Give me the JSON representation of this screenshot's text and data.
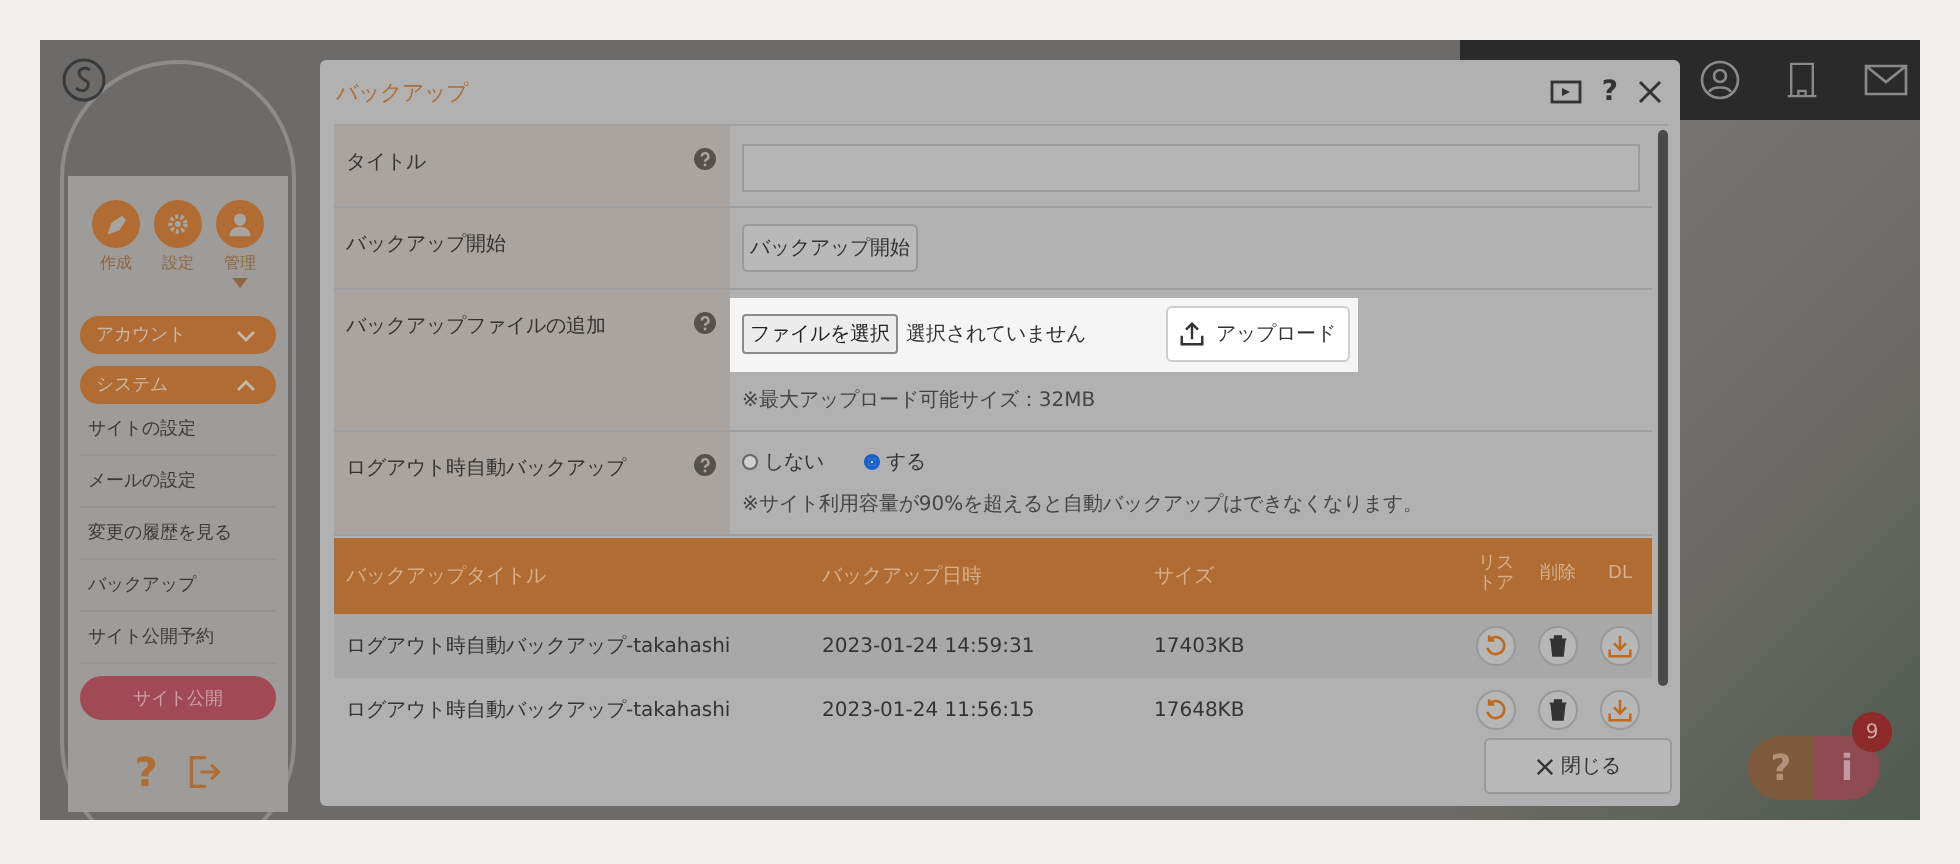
{
  "sidebar": {
    "nav": [
      {
        "kind": "pen",
        "label": "作成",
        "selected": false
      },
      {
        "kind": "gear",
        "label": "設定",
        "selected": false
      },
      {
        "kind": "person",
        "label": "管理",
        "selected": true
      }
    ],
    "sections": [
      {
        "label": "アカウント",
        "expanded": false
      },
      {
        "label": "システム",
        "expanded": true,
        "items": [
          "サイトの設定",
          "メールの設定",
          "変更の履歴を見る",
          "バックアップ",
          "サイト公開予約"
        ]
      }
    ],
    "publish_button": "サイト公開",
    "help_glyph": "?"
  },
  "modal": {
    "title": "バックアップ",
    "help_glyph": "?",
    "form": [
      {
        "kind": "text",
        "label": "タイトル",
        "help": true
      },
      {
        "kind": "button",
        "label": "バックアップ開始",
        "help": false,
        "button": "バックアップ開始"
      },
      {
        "kind": "file",
        "label": "バックアップファイルの追加",
        "help": true,
        "choose_button": "ファイルを選択",
        "status": "選択されていません",
        "upload_button": "アップロード",
        "note": "※最大アップロード可能サイズ：32MB"
      },
      {
        "kind": "radio",
        "label": "ログアウト時自動バックアップ",
        "help": true,
        "options": [
          {
            "label": "しない",
            "selected": false
          },
          {
            "label": "する",
            "selected": true
          }
        ],
        "note": "※サイト利用容量が90%を超えると自動バックアップはできなくなります。"
      }
    ],
    "table": {
      "columns": [
        "バックアップタイトル",
        "バックアップ日時",
        "サイズ",
        "リストア",
        "削除",
        "DL"
      ],
      "rows": [
        {
          "title": "ログアウト時自動バックアップ-takahashi",
          "date": "2023-01-24 14:59:31",
          "size": "17403KB"
        },
        {
          "title": "ログアウト時自動バックアップ-takahashi",
          "date": "2023-01-24 11:56:15",
          "size": "17648KB"
        }
      ]
    },
    "close_button": "閉じる"
  },
  "help_widget": {
    "question": "?",
    "info": "i",
    "badge": "9"
  }
}
